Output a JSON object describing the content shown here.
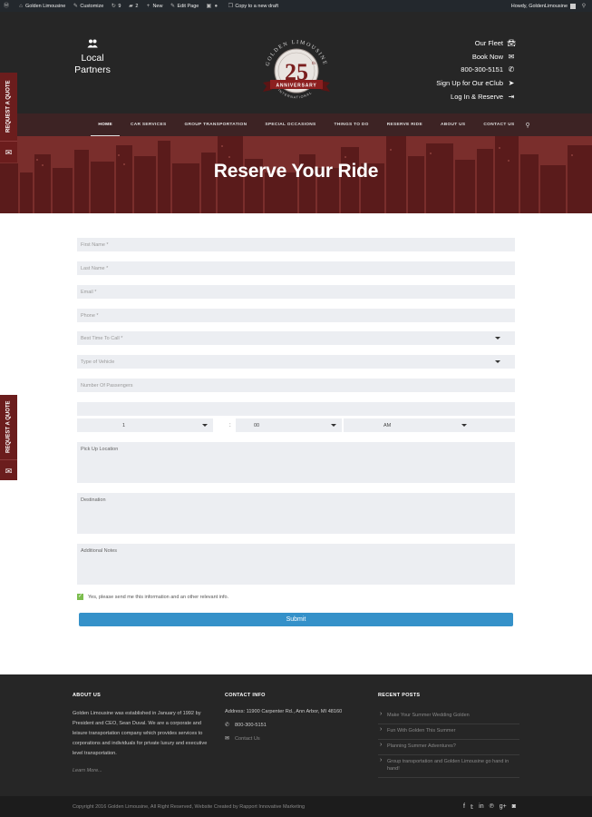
{
  "adminbar": {
    "site_name": "Golden Limousine",
    "customize": "Customize",
    "updates": "9",
    "comments": "2",
    "new": "New",
    "edit_page": "Edit Page",
    "copy_draft": "Copy to a new draft",
    "howdy": "Howdy, GoldenLimousine"
  },
  "header": {
    "local_partners": "Local Partners",
    "logo": {
      "arc_top": "GOLDEN LIMOUSINE",
      "number": "25",
      "sup": "th",
      "ribbon": "ANNIVERSARY",
      "arc_bottom": "INTERNATIONAL"
    },
    "links": [
      {
        "label": "Our Fleet",
        "icon": "car-icon"
      },
      {
        "label": "Book Now",
        "icon": "envelope-icon"
      },
      {
        "label": "800-300-5151",
        "icon": "phone-icon"
      },
      {
        "label": "Sign Up for Our eClub",
        "icon": "paper-plane-icon"
      },
      {
        "label": "Log In & Reserve",
        "icon": "sign-in-icon"
      }
    ]
  },
  "nav": {
    "items": [
      "HOME",
      "CAR SERVICES",
      "GROUP TRANSPORTATION",
      "SPECIAL OCCASIONS",
      "THINGS TO DO",
      "RESERVE RIDE",
      "ABOUT US",
      "CONTACT US"
    ],
    "active": "HOME"
  },
  "hero": {
    "title": "Reserve Your Ride"
  },
  "request_quote": {
    "label": "REQUEST A QUOTE"
  },
  "form": {
    "first_name": "First Name *",
    "last_name": "Last Name *",
    "email": "Email *",
    "phone": "Phone *",
    "best_time": "Best Time To Call *",
    "vehicle": "Type of Vehicle",
    "passengers": "Number Of Passengers",
    "date": "",
    "hour": "1",
    "colon": ":",
    "minute": "00",
    "ampm": "AM",
    "pickup": "Pick Up Location",
    "destination": "Destination",
    "notes": "Additional Notes",
    "consent": "Yes, please send me this information and an other relevant info.",
    "submit": "Submit"
  },
  "footer": {
    "about": {
      "heading": "ABOUT US",
      "text": "Golden Limousine was established in January of 1992 by President and CEO, Sean Duval. We are a corporate and leisure transportation company which provides services to corporations and individuals for private luxury and executive level transportation.",
      "more": "Learn More..."
    },
    "contact": {
      "heading": "CONTACT INFO",
      "address": "Address: 11900 Carpenter Rd., Ann Arbor, MI 48160",
      "phone": "800-300-5151",
      "contact_us": "Contact Us"
    },
    "recent": {
      "heading": "RECENT POSTS",
      "posts": [
        "Make Your Summer Wedding Golden",
        "Fun With Golden This Summer",
        "Planning Summer Adventures?",
        "Group transportation and Golden Limousine go hand in hand!"
      ]
    },
    "copyright": "Copyright 2016 Golden Limousine, All Right Reserved, Website Created by Rapport Innovative Marketing",
    "social": [
      "facebook-icon",
      "twitter-icon",
      "linkedin-icon",
      "pinterest-icon",
      "google-plus-icon",
      "instagram-icon"
    ]
  },
  "colors": {
    "brand_red": "#6b1d1d",
    "header_bg": "#262626",
    "submit_blue": "#3591c9",
    "field_bg": "#eceef2"
  }
}
